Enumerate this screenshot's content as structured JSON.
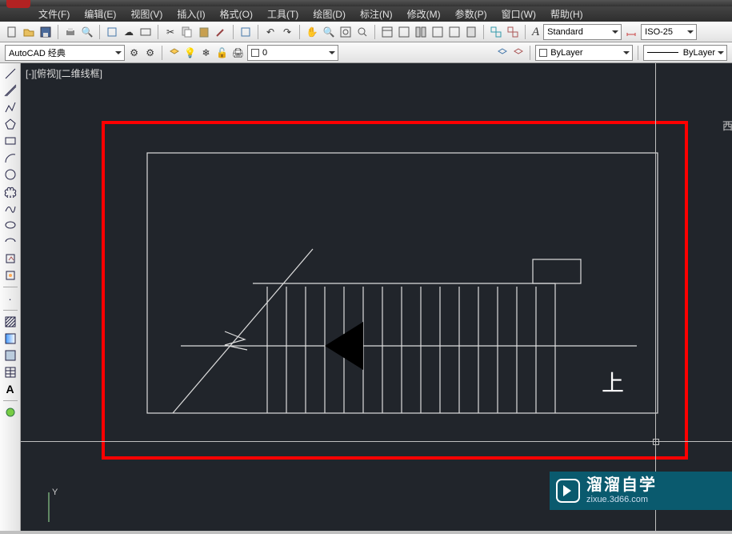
{
  "menu": {
    "file": "文件(F)",
    "edit": "编辑(E)",
    "view": "视图(V)",
    "insert": "插入(I)",
    "format": "格式(O)",
    "tools": "工具(T)",
    "draw": "绘图(D)",
    "annotate": "标注(N)",
    "modify": "修改(M)",
    "param": "参数(P)",
    "window": "窗口(W)",
    "help": "帮助(H)"
  },
  "toolbar": {
    "workspace": "AutoCAD 经典",
    "layer_name": "0",
    "text_style": "Standard",
    "dim_style": "ISO-25",
    "bylayer": "ByLayer",
    "linetype": "ByLayer"
  },
  "viewport": {
    "label": "[-][俯视][二维线框]",
    "direction_char": "上",
    "ucs_y": "Y"
  },
  "watermark": {
    "title": "溜溜自学",
    "sub": "zixue.3d66.com"
  }
}
